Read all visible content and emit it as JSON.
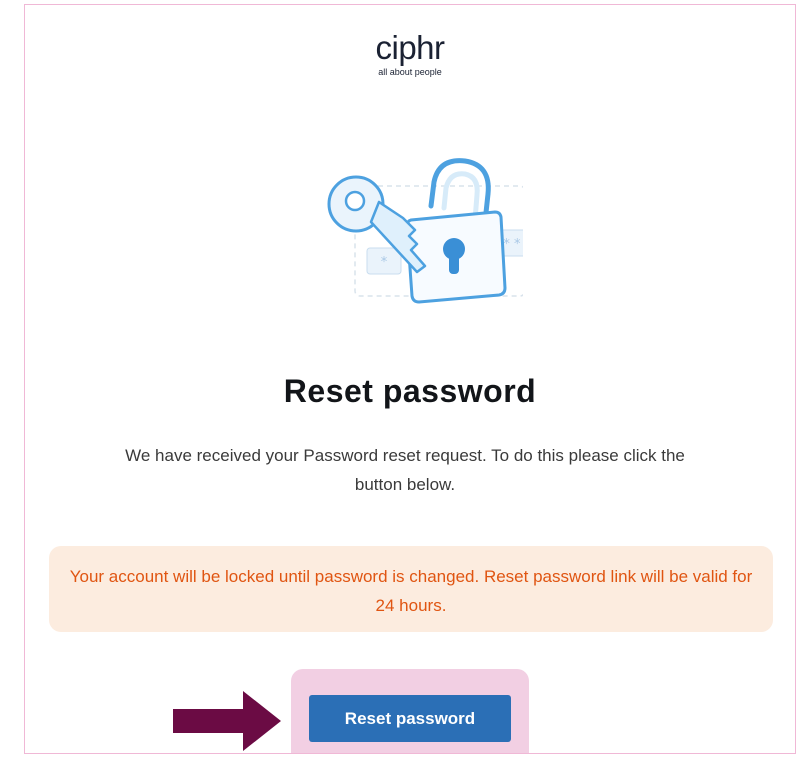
{
  "brand": {
    "name": "ciphr",
    "tagline": "all about people"
  },
  "hero": {
    "icon": "padlock-and-key-icon",
    "password_mask_left": "*",
    "password_mask_right": "* *"
  },
  "content": {
    "title": "Reset password",
    "message": "We have received your Password reset request. To do this please click the button below.",
    "notice": "Your account will be locked until password is changed. Reset password link will be valid for 24 hours."
  },
  "actions": {
    "reset_label": "Reset password"
  },
  "colors": {
    "button": "#2b6fb6",
    "notice_background": "#fcecdf",
    "notice_text": "#e05512",
    "highlight": "#f2cfe3",
    "pointer_arrow": "#6b0b44",
    "frame_border": "#f0b8d6"
  }
}
